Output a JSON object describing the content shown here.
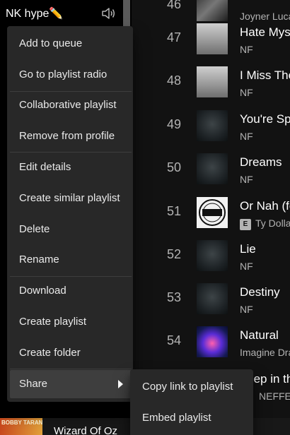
{
  "sidebar": {
    "title": "NK hype✏️",
    "speaker_icon": "speaker-icon"
  },
  "tracks": [
    {
      "num": "46",
      "title": "",
      "artist": "Joyner Lucas",
      "art": "bw",
      "explicit": false
    },
    {
      "num": "47",
      "title": "Hate Myself",
      "artist": "NF",
      "art": "gray",
      "explicit": false
    },
    {
      "num": "48",
      "title": "I Miss The Days",
      "artist": "NF",
      "art": "gray",
      "explicit": false
    },
    {
      "num": "49",
      "title": "You're Special",
      "artist": "NF",
      "art": "dark",
      "explicit": false
    },
    {
      "num": "50",
      "title": "Dreams",
      "artist": "NF",
      "art": "dark",
      "explicit": false
    },
    {
      "num": "51",
      "title": "Or Nah (feat.",
      "artist": "Ty Dolla $ign",
      "art": "white",
      "explicit": true,
      "explicit_label": "E"
    },
    {
      "num": "52",
      "title": "Lie",
      "artist": "NF",
      "art": "dark",
      "explicit": false
    },
    {
      "num": "53",
      "title": "Destiny",
      "artist": "NF",
      "art": "dark",
      "explicit": false
    },
    {
      "num": "54",
      "title": "Natural",
      "artist": "Imagine Dragons",
      "art": "blue",
      "explicit": false
    },
    {
      "num": "",
      "title": "Sleep in the",
      "artist": "NEFFEX",
      "art": "dark",
      "explicit": false
    }
  ],
  "context_menu": {
    "items": [
      "Add to queue",
      "Go to playlist radio",
      "Collaborative playlist",
      "Remove from profile",
      "Edit details",
      "Create similar playlist",
      "Delete",
      "Rename",
      "Download",
      "Create playlist",
      "Create folder",
      "Share"
    ]
  },
  "share_submenu": {
    "items": [
      "Copy link to playlist",
      "Embed playlist"
    ]
  },
  "now_playing": {
    "cover_text": "BOBBY TARANTINO II",
    "title": "Wizard Of Oz"
  },
  "colors": {
    "background": "#121212",
    "menu_bg": "#282828",
    "menu_hover": "#3e3e3e",
    "secondary_text": "#b3b3b3"
  }
}
